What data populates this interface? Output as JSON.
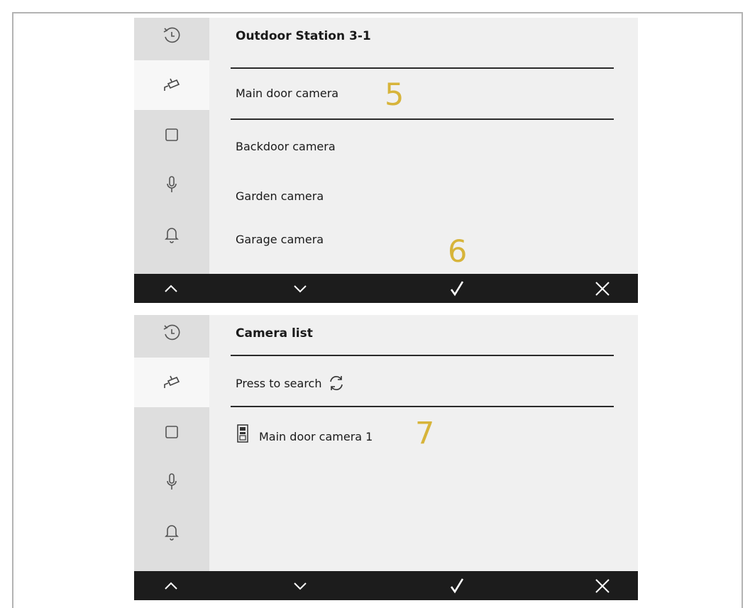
{
  "screen1": {
    "title": "Outdoor Station 3-1",
    "items": [
      {
        "label": "Main door camera",
        "selected": true
      },
      {
        "label": "Backdoor camera"
      },
      {
        "label": "Garden camera"
      },
      {
        "label": "Garage camera"
      }
    ],
    "callouts": [
      "5",
      "6"
    ]
  },
  "screen2": {
    "title": "Camera list",
    "search_label": "Press to search",
    "items": [
      {
        "label": "Main door camera 1",
        "icon": "door-station-icon"
      }
    ],
    "callouts": [
      "7"
    ]
  },
  "sidebar_icons": [
    "history-icon",
    "camera-icon",
    "square-icon",
    "microphone-icon",
    "bell-icon"
  ],
  "toolbar_icons": [
    "chevron-up-icon",
    "chevron-down-icon",
    "checkmark-icon",
    "close-icon"
  ],
  "colors": {
    "toolbar": "#1c1c1c",
    "sidebar": "#dedede",
    "sidebar_active": "#f7f7f7",
    "content": "#f0f0f0",
    "callout": "#d7b43a"
  }
}
